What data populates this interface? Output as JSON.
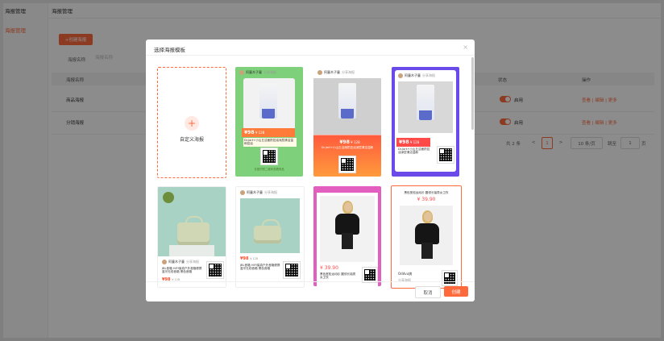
{
  "app": {
    "sidebar_title": "海报管理",
    "sidebar_item": "海报管理",
    "topbar_title": "海报管理",
    "create_button": "+创建海报",
    "filter_label": "海报名称",
    "filter_placeholder": "海报名称"
  },
  "table": {
    "headers": [
      "海报名称",
      "状态",
      "操作"
    ],
    "rows": [
      {
        "name": "商品海报",
        "status": "启用",
        "ops": "查看 | 编辑 | 更多"
      },
      {
        "name": "分销海报",
        "status": "启用",
        "ops": "查看 | 编辑 | 更多"
      }
    ]
  },
  "pagination": {
    "total": "共 2 条",
    "prev": "<",
    "current": "1",
    "next": ">",
    "page_size": "10 条/页",
    "goto_label": "跳至",
    "goto_value": "1",
    "goto_unit": "页"
  },
  "modal": {
    "title": "选择海报模板",
    "close": "×",
    "custom_label": "自定义海报",
    "custom_plus": "+",
    "cancel": "取消",
    "confirm": "创建",
    "templates": [
      {
        "shop": "阿童木子童",
        "sub": "分享海报",
        "price": "¥98",
        "price_sub": "¥ 128",
        "desc": "Dr.Jart+小山丘洁面奶控油深层清洁温和控油",
        "hint": "长按识别二维码查看商品"
      },
      {
        "shop": "阿童木子童",
        "sub": "分享海报",
        "price": "¥98",
        "price_sub": "¥ 128",
        "desc": "Dr.Jart+小山丘洁面奶控油深层清洁温和"
      },
      {
        "shop": "阿童木子童",
        "sub": "分享海报",
        "price": "¥98",
        "price_sub": "¥ 128",
        "desc": "Dr.Jart+小山丘洁面奶控油深层清洁温和"
      },
      {
        "shop": "阿童木子童",
        "sub": "分享海报",
        "price": "¥98",
        "price_sub": "¥ 128",
        "desc": "JBL音箱 HIFI保真户外音箱便携蓝牙无线音箱 黑色音箱"
      },
      {
        "shop": "阿童木子童",
        "sub": "分享海报",
        "price": "¥98",
        "price_sub": "¥ 128",
        "desc": "JBL音箱 HIFI保真户外音箱便携蓝牙无线音箱 黑色音箱"
      },
      {
        "price": "¥ 39.90",
        "desc": "黑色宽松运动衫 圆领长袖男女卫衣"
      },
      {
        "headline": "黑色宽松运动衫 圆领长袖男女卫衣",
        "price": "¥ 39.90",
        "shop": "Oddvu旗",
        "sub": "分享海报"
      }
    ]
  }
}
